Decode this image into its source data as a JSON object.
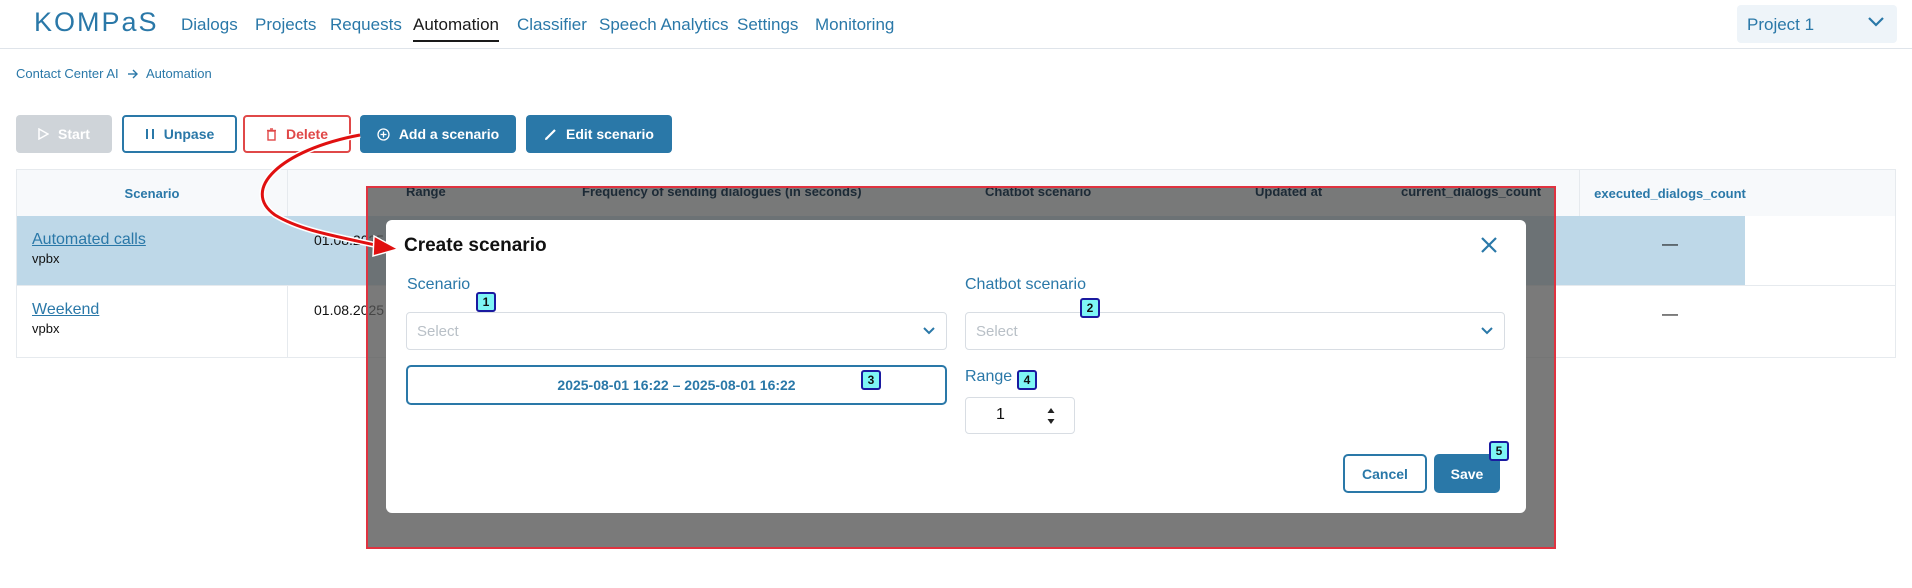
{
  "header": {
    "logo": "KOMPaS",
    "nav": [
      "Dialogs",
      "Projects",
      "Requests",
      "Automation",
      "Classifier",
      "Speech Analytics",
      "Settings",
      "Monitoring"
    ],
    "active_nav": "Automation",
    "project": "Project 1"
  },
  "breadcrumb": {
    "root": "Contact Center AI",
    "current": "Automation"
  },
  "toolbar": {
    "start": "Start",
    "unpase": "Unpase",
    "delete": "Delete",
    "add": "Add a scenario",
    "edit": "Edit scenario"
  },
  "table": {
    "columns": {
      "scenario": "Scenario",
      "range": "Range",
      "frequency": "Frequency of sending dialogues (in seconds)",
      "chatbot": "Chatbot scenario",
      "updated": "Updated at",
      "current": "current_dialogs_count",
      "executed": "executed_dialogs_count"
    },
    "rows": [
      {
        "name": "Automated calls",
        "sub": "vpbx",
        "date": "01.08.2025",
        "executed": "—"
      },
      {
        "name": "Weekend",
        "sub": "vpbx",
        "date": "01.08.2025",
        "executed": "—"
      }
    ]
  },
  "modal": {
    "title": "Create scenario",
    "scenario_label": "Scenario",
    "scenario_placeholder": "Select",
    "chatbot_label": "Chatbot scenario",
    "chatbot_placeholder": "Select",
    "date_range": "2025-08-01 16:22 – 2025-08-01 16:22",
    "range_label": "Range",
    "range_value": "1",
    "cancel": "Cancel",
    "save": "Save"
  },
  "markers": [
    "1",
    "2",
    "3",
    "4",
    "5"
  ],
  "colors": {
    "accent": "#2a78a8",
    "danger": "#e04848",
    "highlight": "#e03340",
    "marker": "#7ef5f5",
    "selected_row": "#bed8e8"
  },
  "icons": [
    "play-icon",
    "pause-icon",
    "trash-icon",
    "plus-circle-icon",
    "pencil-icon",
    "chevron-down-icon",
    "close-icon",
    "arrow-right-icon"
  ]
}
